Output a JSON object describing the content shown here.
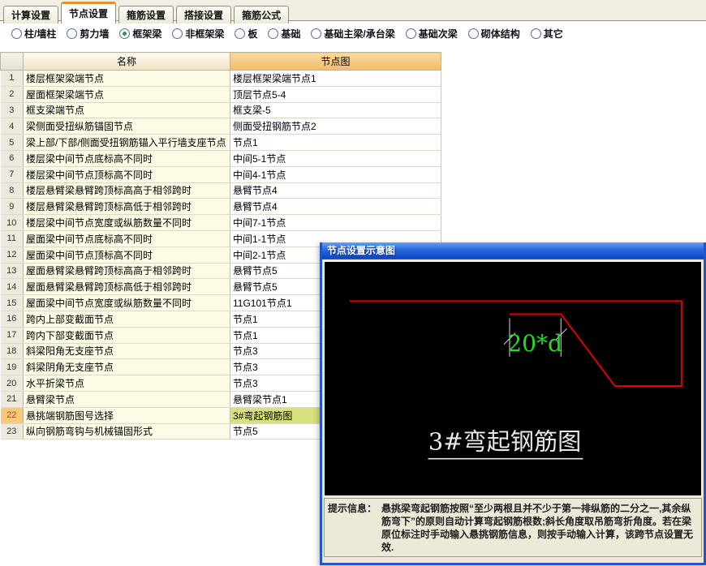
{
  "tabs": [
    {
      "label": "计算设置",
      "active": false
    },
    {
      "label": "节点设置",
      "active": true
    },
    {
      "label": "箍筋设置",
      "active": false
    },
    {
      "label": "搭接设置",
      "active": false
    },
    {
      "label": "箍筋公式",
      "active": false
    }
  ],
  "radios": [
    {
      "label": "柱/墙柱",
      "selected": false
    },
    {
      "label": "剪力墙",
      "selected": false
    },
    {
      "label": "框架梁",
      "selected": true
    },
    {
      "label": "非框架梁",
      "selected": false
    },
    {
      "label": "板",
      "selected": false
    },
    {
      "label": "基础",
      "selected": false
    },
    {
      "label": "基础主梁/承台梁",
      "selected": false
    },
    {
      "label": "基础次梁",
      "selected": false
    },
    {
      "label": "砌体结构",
      "selected": false
    },
    {
      "label": "其它",
      "selected": false
    }
  ],
  "table": {
    "columns": {
      "index": "",
      "name": "名称",
      "diagram": "节点图"
    },
    "rows": [
      {
        "n": 1,
        "name": "楼层框架梁端节点",
        "value": "楼层框架梁端节点1",
        "selected": false
      },
      {
        "n": 2,
        "name": "屋面框架梁端节点",
        "value": "顶层节点5-4",
        "selected": false
      },
      {
        "n": 3,
        "name": "框支梁端节点",
        "value": "框支梁-5",
        "selected": false
      },
      {
        "n": 4,
        "name": "梁侧面受扭纵筋锚固节点",
        "value": "侧面受扭钢筋节点2",
        "selected": false
      },
      {
        "n": 5,
        "name": "梁上部/下部/侧面受扭钢筋锚入平行墙支座节点",
        "value": "节点1",
        "selected": false
      },
      {
        "n": 6,
        "name": "楼层梁中间节点底标高不同时",
        "value": "中间5-1节点",
        "selected": false
      },
      {
        "n": 7,
        "name": "楼层梁中间节点顶标高不同时",
        "value": "中间4-1节点",
        "selected": false
      },
      {
        "n": 8,
        "name": "楼层悬臂梁悬臂跨顶标高高于相邻跨时",
        "value": "悬臂节点4",
        "selected": false
      },
      {
        "n": 9,
        "name": "楼层悬臂梁悬臂跨顶标高低于相邻跨时",
        "value": "悬臂节点4",
        "selected": false
      },
      {
        "n": 10,
        "name": "楼层梁中间节点宽度或纵筋数量不同时",
        "value": "中间7-1节点",
        "selected": false
      },
      {
        "n": 11,
        "name": "屋面梁中间节点底标高不同时",
        "value": "中间1-1节点",
        "selected": false
      },
      {
        "n": 12,
        "name": "屋面梁中间节点顶标高不同时",
        "value": "中间2-1节点",
        "selected": false
      },
      {
        "n": 13,
        "name": "屋面悬臂梁悬臂跨顶标高高于相邻跨时",
        "value": "悬臂节点5",
        "selected": false
      },
      {
        "n": 14,
        "name": "屋面悬臂梁悬臂跨顶标高低于相邻跨时",
        "value": "悬臂节点5",
        "selected": false
      },
      {
        "n": 15,
        "name": "屋面梁中间节点宽度或纵筋数量不同时",
        "value": "11G101节点1",
        "selected": false
      },
      {
        "n": 16,
        "name": "跨内上部变截面节点",
        "value": "节点1",
        "selected": false
      },
      {
        "n": 17,
        "name": "跨内下部变截面节点",
        "value": "节点1",
        "selected": false
      },
      {
        "n": 18,
        "name": "斜梁阳角无支座节点",
        "value": "节点3",
        "selected": false
      },
      {
        "n": 19,
        "name": "斜梁阴角无支座节点",
        "value": "节点3",
        "selected": false
      },
      {
        "n": 20,
        "name": "水平折梁节点",
        "value": "节点3",
        "selected": false
      },
      {
        "n": 21,
        "name": "悬臂梁节点",
        "value": "悬臂梁节点1",
        "selected": false
      },
      {
        "n": 22,
        "name": "悬挑端钢筋图号选择",
        "value": "3#弯起钢筋图",
        "selected": true
      },
      {
        "n": 23,
        "name": "纵向钢筋弯钩与机械锚固形式",
        "value": "节点5",
        "selected": false
      }
    ]
  },
  "popup": {
    "title": "节点设置示意图",
    "canvas": {
      "dim_label": "20*d",
      "caption": "3#弯起钢筋图"
    },
    "hint": {
      "label": "提示信息：",
      "text": "悬挑梁弯起钢筋按照“至少两根且并不少于第一排纵筋的二分之一,其余纵筋弯下”的原则自动计算弯起钢筋根数;斜长角度取吊筋弯折角度。若在梁原位标注时手动输入悬挑钢筋信息，则按手动输入计算，该跨节点设置无效."
    }
  },
  "colors": {
    "titlebar_blue": "#2a6cdf",
    "rebar_red": "#e00000",
    "dim_green": "#22dd22",
    "selected_cell_olive": "#d9e07e",
    "selected_rownum_orange": "#f8c87c",
    "header_orange": "#f2bb6a",
    "row_yellow": "#fcfce6",
    "active_tab_accent": "#e5912d"
  }
}
